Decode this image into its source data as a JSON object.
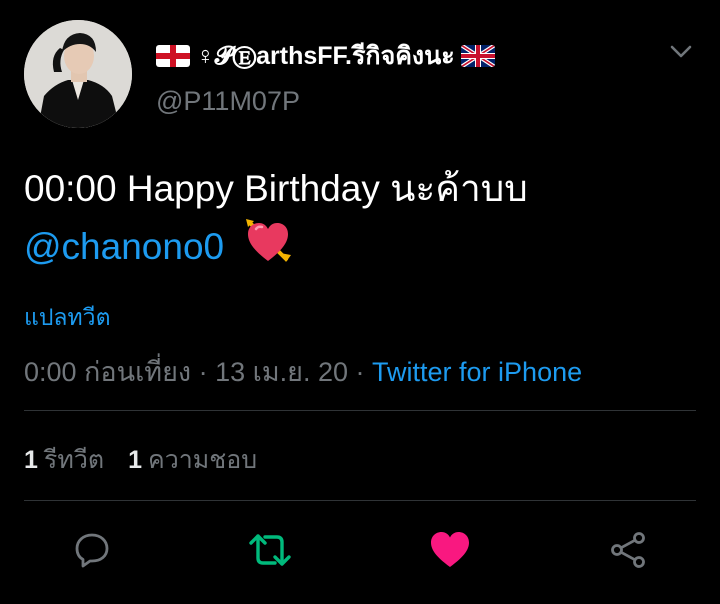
{
  "user": {
    "display_name": "♀𝓟ⒺarthsFF.รีกิจคิงนะ",
    "handle": "@P11M07P"
  },
  "tweet": {
    "text_line1": "00:00 Happy Birthday นะค้าบบ",
    "mention": "@chanono0",
    "emoji": "heart-with-arrow"
  },
  "translate_label": "แปลทวีต",
  "meta": {
    "time": "0:00 ก่อนเที่ยง",
    "separator1": " · ",
    "date": "13 เม.ย. 20",
    "separator2": " · ",
    "source": "Twitter for iPhone"
  },
  "stats": {
    "retweets_count": "1",
    "retweets_label": "รีทวีต",
    "likes_count": "1",
    "likes_label": "ความชอบ"
  },
  "icons": {
    "reply": "comment-icon",
    "retweet": "retweet-icon",
    "like": "heart-icon",
    "share": "share-icon",
    "caret": "chevron-down-icon"
  },
  "colors": {
    "background": "#000000",
    "link": "#1d9bf0",
    "secondary_text": "#71767b",
    "retweet_active": "#00ba7c",
    "like_active": "#f91880"
  }
}
